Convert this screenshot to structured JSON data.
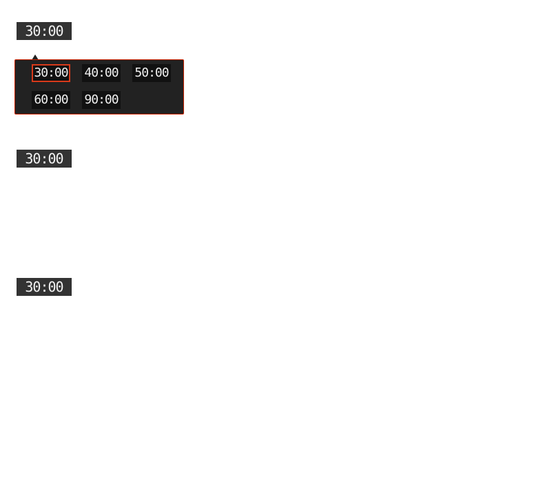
{
  "timers": [
    {
      "value": "30:00"
    },
    {
      "value": "30:00"
    },
    {
      "value": "30:00"
    }
  ],
  "duration_popup": {
    "selected": "30:00",
    "options": [
      "30:00",
      "40:00",
      "50:00",
      "60:00",
      "90:00"
    ]
  },
  "colors": {
    "timer_bg": "#333333",
    "popup_bg": "#222222",
    "option_bg": "#111111",
    "accent": "#d93a1a",
    "text": "#f0f0f0"
  }
}
